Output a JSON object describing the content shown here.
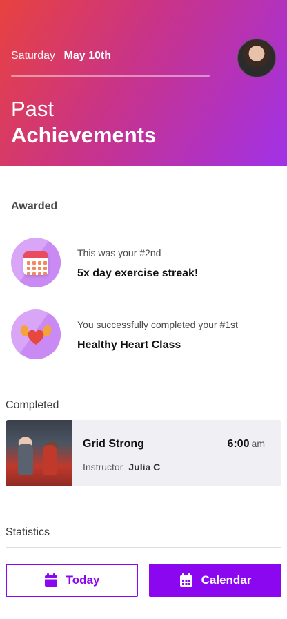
{
  "header": {
    "day_of_week": "Saturday",
    "date": "May 10th",
    "title_line1": "Past",
    "title_line2": "Achievements",
    "gradient_colors": [
      "#e8423f",
      "#c8338a",
      "#a132e8"
    ]
  },
  "awarded": {
    "label": "Awarded",
    "items": [
      {
        "icon": "calendar-icon",
        "subtitle": "This was your #2nd",
        "title": "5x day exercise streak!"
      },
      {
        "icon": "muscle-heart-icon",
        "subtitle": "You successfully completed your #1st",
        "title": "Healthy Heart Class"
      }
    ]
  },
  "completed": {
    "label": "Completed",
    "class": {
      "name": "Grid Strong",
      "time": "6:00",
      "ampm": "am",
      "instructor_label": "Instructor",
      "instructor_name": "Julia C"
    }
  },
  "statistics": {
    "label": "Statistics"
  },
  "footer": {
    "today_label": "Today",
    "calendar_label": "Calendar",
    "accent_color": "#8b07f0"
  }
}
